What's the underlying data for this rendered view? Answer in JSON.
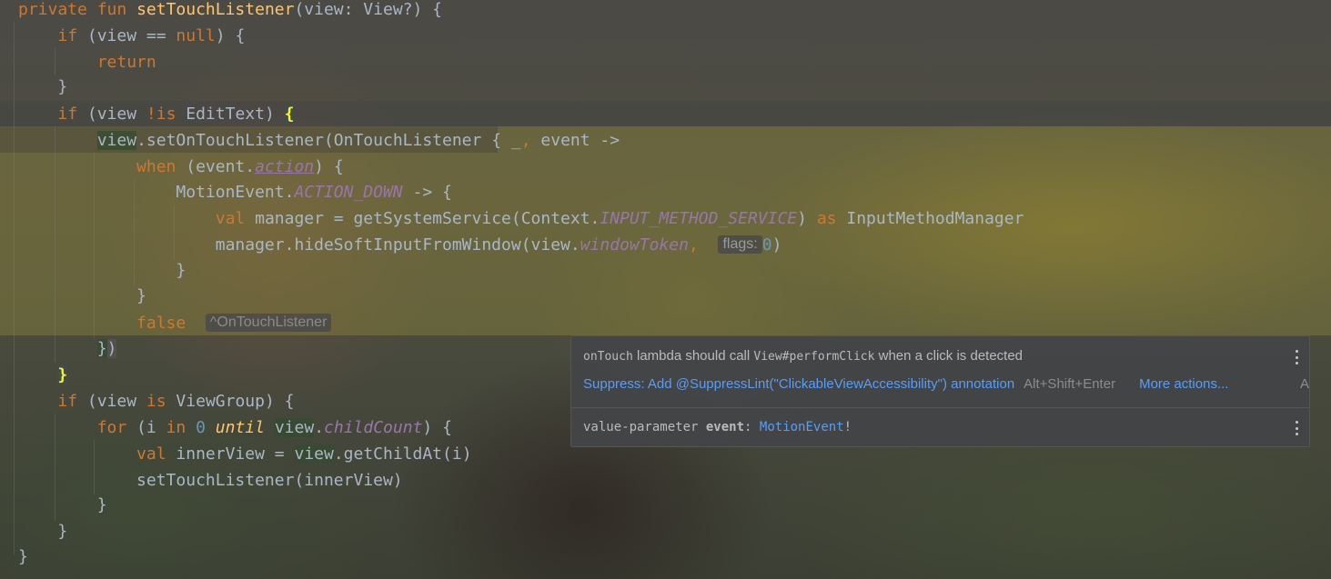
{
  "code": {
    "l1": {
      "private": "private",
      "fun": "fun",
      "name": "setTouchListener",
      "rest": "(view: View?) {"
    },
    "l2": {
      "if": "if",
      "rest": " (view == ",
      "null": "null",
      "end": ") {"
    },
    "l3": {
      "return": "return"
    },
    "l4": {
      "brace": "}"
    },
    "l5": {
      "if": "if",
      "rest": " (view ",
      "notis": "!is",
      "type": " EditText) ",
      "brace": "{"
    },
    "l6": {
      "view": "view",
      "call": ".setOnTouchListener(OnTouchListener ",
      "lb": "{",
      "us": " _",
      "comma": ",",
      "ev": " event ->"
    },
    "l7": {
      "when": "when",
      "open": " (event.",
      "action": "action",
      "close": ") {"
    },
    "l8": {
      "cls": "MotionEvent.",
      "const": "ACTION_DOWN",
      "arrow": " -> {"
    },
    "l9": {
      "val": "val",
      "mid": " manager = getSystemService(Context.",
      "const": "INPUT_METHOD_SERVICE",
      "close": ") ",
      "as": "as",
      "type": " InputMethodManager"
    },
    "l10": {
      "start": "manager.hideSoftInputFromWindow(view.",
      "prop": "windowToken",
      "comma": ",",
      "hint": "flags:",
      "zero": "0",
      "close": ")"
    },
    "l11": {
      "brace": "}"
    },
    "l12": {
      "brace": "}"
    },
    "l13": {
      "false": "false",
      "hint": "^OnTouchListener"
    },
    "l14": {
      "brace": "}",
      "paren": ")"
    },
    "l15": {
      "brace": "}"
    },
    "l16": {
      "if": "if",
      "rest": " (view ",
      "is": "is",
      "type": " ViewGroup) {"
    },
    "l17": {
      "for": "for",
      "open": " (i ",
      "in": "in",
      "zero": "0",
      "until": "until",
      "view": "view",
      "dot": ".",
      "prop": "childCount",
      "close": ") {"
    },
    "l18": {
      "val": "val",
      "mid": " innerView = ",
      "view": "view",
      "call": ".getChildAt(i)"
    },
    "l19": {
      "call": "setTouchListener(innerView)"
    },
    "l20": {
      "brace": "}"
    },
    "l21": {
      "brace": "}"
    },
    "l22": {
      "brace": "}"
    }
  },
  "popup": {
    "warn_code1": "onTouch",
    "warn_text1": " lambda should call ",
    "warn_code2": "View#performClick",
    "warn_text2": " when a click is detected",
    "suppress": "Suppress: Add @SuppressLint(\"ClickableViewAccessibility\") annotation",
    "shortcut": "Alt+Shift+Enter",
    "more": "More actions...",
    "clip": "A",
    "param_kw": "value-parameter",
    "param_name": "event",
    "param_colon": ":",
    "param_type": "MotionEvent",
    "param_bang": "!"
  },
  "colors": {
    "keyword": "#cc7832",
    "function": "#ffc66d",
    "number": "#6897bb",
    "constant": "#9876aa",
    "text": "#a9b7c6",
    "link": "#589df6"
  }
}
